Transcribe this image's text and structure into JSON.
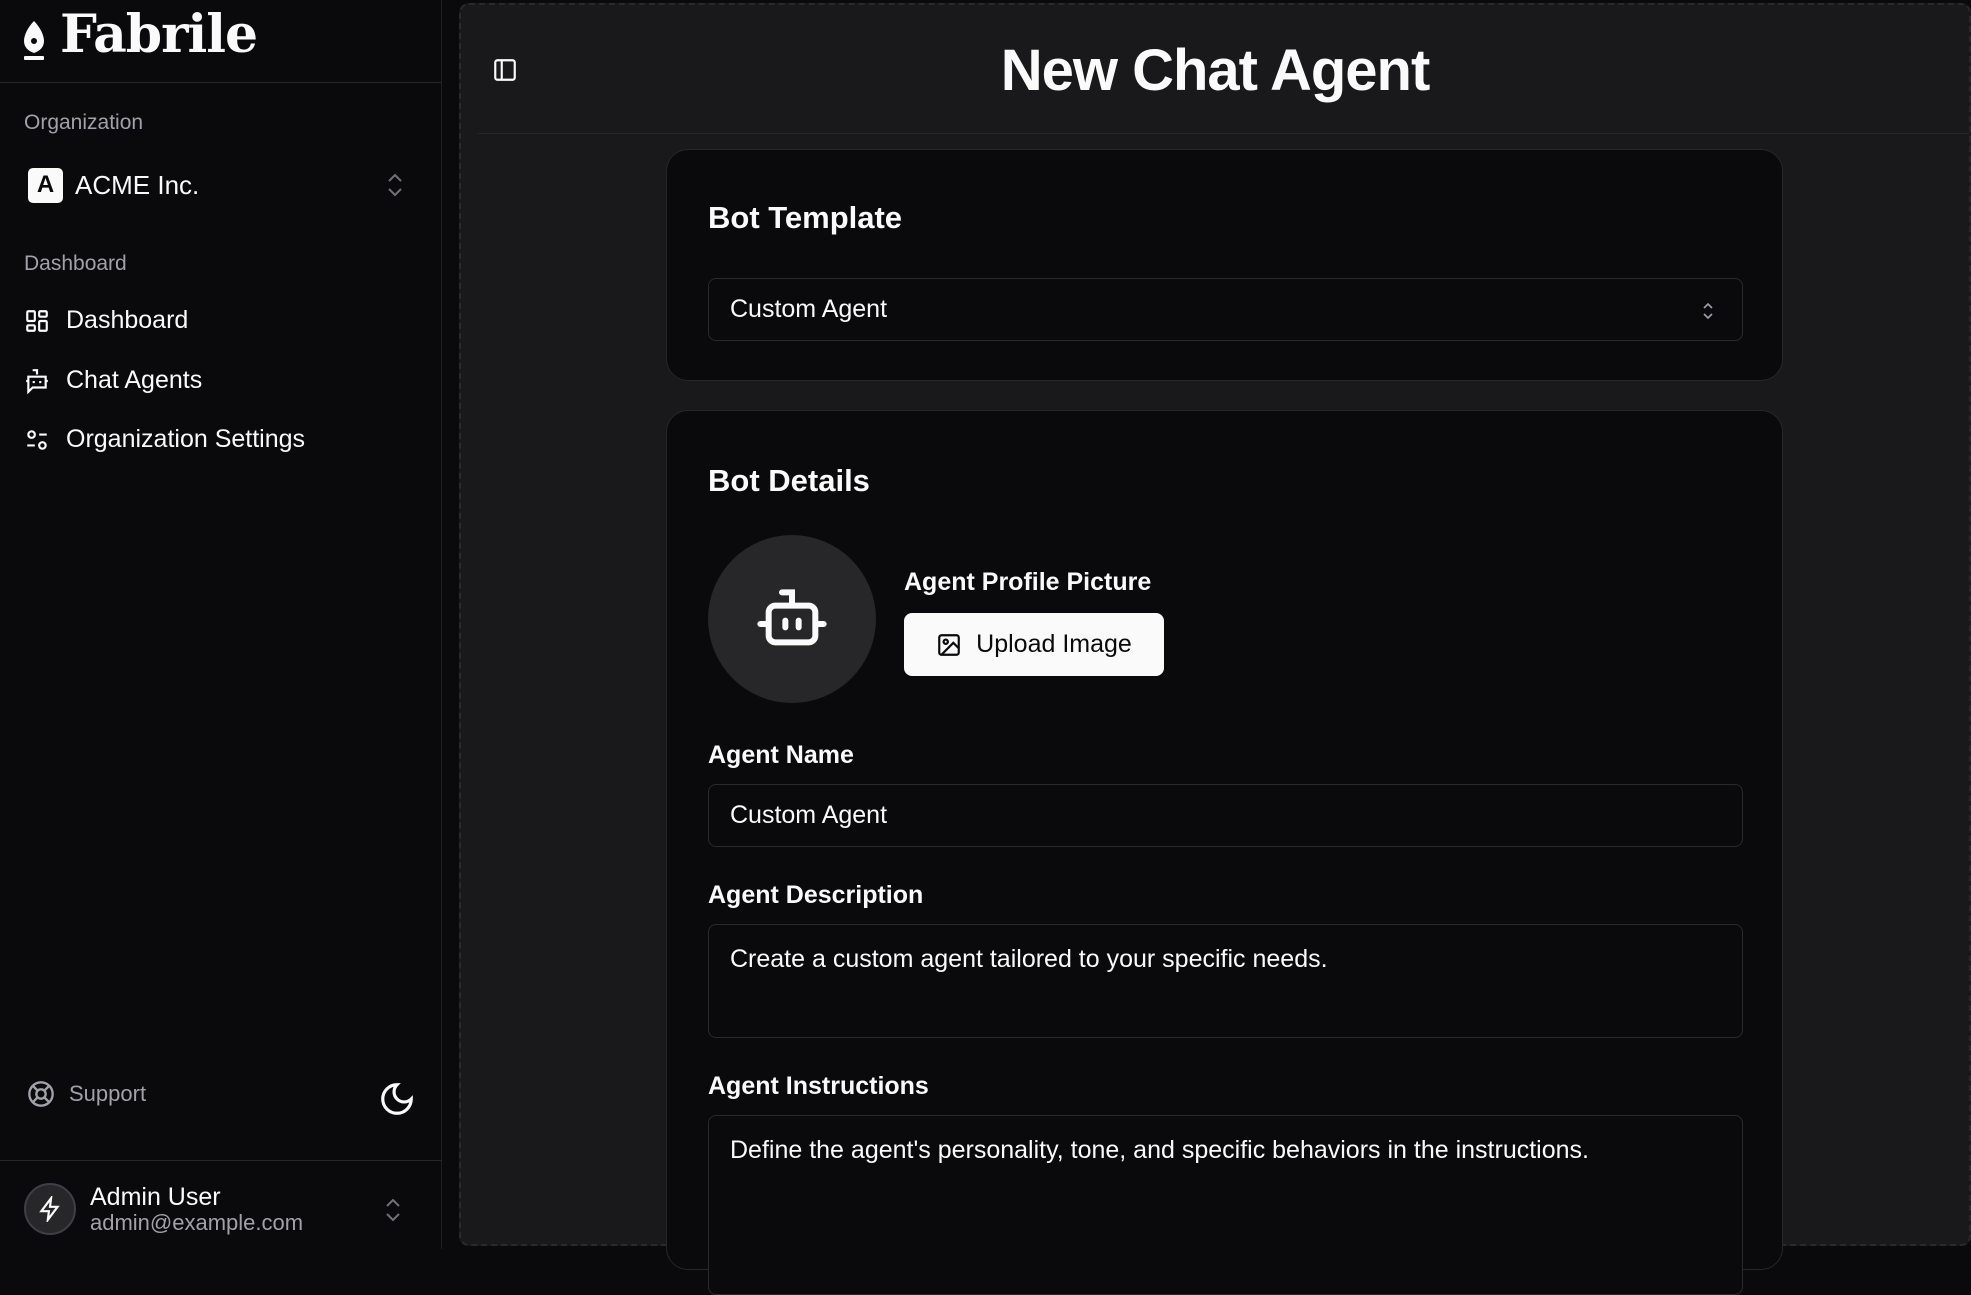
{
  "sidebar": {
    "brand": "Fabrile",
    "org_label": "Organization",
    "org_initial": "A",
    "org_name": "ACME Inc.",
    "section_label": "Dashboard",
    "items": [
      {
        "label": "Dashboard",
        "icon": "layout-dashboard-icon"
      },
      {
        "label": "Chat Agents",
        "icon": "bot-message-icon"
      },
      {
        "label": "Organization Settings",
        "icon": "settings-sliders-icon"
      }
    ],
    "support": "Support",
    "user": {
      "name": "Admin User",
      "email": "admin@example.com"
    }
  },
  "header": {
    "title": "New Chat Agent"
  },
  "template_card": {
    "title": "Bot Template",
    "selected": "Custom Agent"
  },
  "details_card": {
    "title": "Bot Details",
    "picture_label": "Agent Profile Picture",
    "upload_label": "Upload Image",
    "name_label": "Agent Name",
    "name_value": "Custom Agent",
    "description_label": "Agent Description",
    "description_value": "Create a custom agent tailored to your specific needs.",
    "instructions_label": "Agent Instructions",
    "instructions_value": "Define the agent's personality, tone, and specific behaviors in the instructions."
  },
  "colors": {
    "sidebar_bg": "#0a0a0c",
    "main_bg": "#19191b",
    "card_bg": "#0a0a0c",
    "border": "#27272a",
    "text": "#fafafa",
    "muted": "#a1a1aa"
  }
}
